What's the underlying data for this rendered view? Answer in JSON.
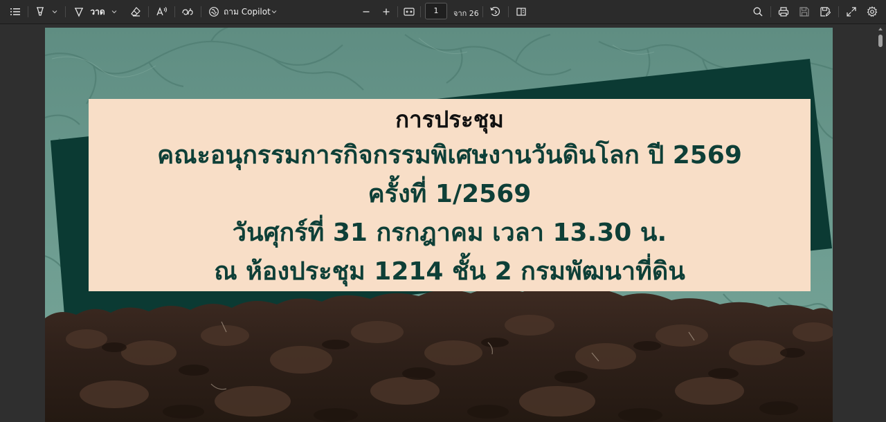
{
  "toolbar": {
    "draw_label": "วาด",
    "copilot_label": "ถาม Copilot",
    "page_current": "1",
    "page_of": "จาก 26",
    "icons": [
      "contents-icon",
      "highlight-icon",
      "draw-icon",
      "erase-icon",
      "read-aloud-icon",
      "translate-icon",
      "copilot-icon",
      "zoom-out-icon",
      "zoom-in-icon",
      "fit-page-icon",
      "rotate-icon",
      "page-view-icon",
      "search-icon",
      "print-icon",
      "save-icon",
      "save-as-icon",
      "fullscreen-icon",
      "settings-icon"
    ]
  },
  "slide": {
    "title": "การประชุม",
    "committee": "คณะอนุกรรมการกิจกรรมพิเศษงานวันดินโลก ปี 2569",
    "session": "ครั้งที่ 1/2569",
    "datetime": "วันศุกร์ที่ 31 กรกฎาคม เวลา 13.30 น.",
    "venue": "ณ ห้องประชุม 1214 ชั้น 2 กรมพัฒนาที่ดิน"
  },
  "colors": {
    "toolbar_bg": "#2b2b2b",
    "viewer_bg": "#2f2f2f",
    "slide_sky": "#6f9a8e",
    "dark_band": "#0b3a33",
    "banner_bg": "#f8dec7",
    "heading_text": "#111111",
    "body_text": "#0e3f37",
    "soil": "#3a2a22"
  }
}
